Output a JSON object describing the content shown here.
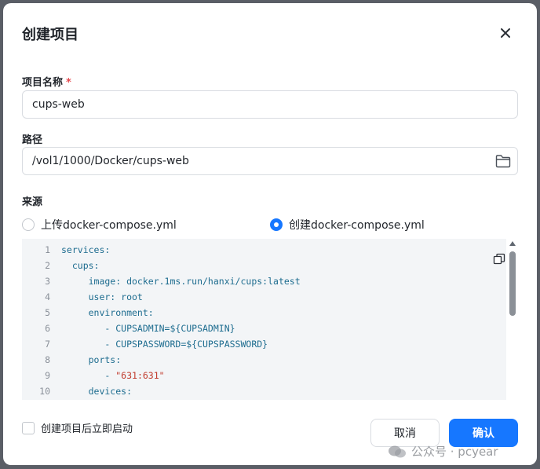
{
  "dialog": {
    "title": "创建项目",
    "close_icon": "close-icon"
  },
  "form": {
    "name_label": "项目名称",
    "name_required_mark": "*",
    "name_value": "cups-web",
    "path_label": "路径",
    "path_value": "/vol1/1000/Docker/cups-web",
    "folder_icon": "folder-icon",
    "source_label": "来源",
    "source_options": [
      {
        "label": "上传docker-compose.yml",
        "selected": false
      },
      {
        "label": "创建docker-compose.yml",
        "selected": true
      }
    ]
  },
  "editor": {
    "lines": [
      {
        "n": "1",
        "text": "services:"
      },
      {
        "n": "2",
        "text": "  cups:"
      },
      {
        "n": "3",
        "text": "     image: docker.1ms.run/hanxi/cups:latest"
      },
      {
        "n": "4",
        "text": "     user: root"
      },
      {
        "n": "5",
        "text": "     environment:"
      },
      {
        "n": "6",
        "text": "        - CUPSADMIN=${CUPSADMIN}"
      },
      {
        "n": "7",
        "text": "        - CUPSPASSWORD=${CUPSPASSWORD}"
      },
      {
        "n": "8",
        "text": "     ports:"
      },
      {
        "n": "9",
        "text": "        - ",
        "str": "\"631:631\""
      },
      {
        "n": "10",
        "text": "     devices:"
      }
    ],
    "copy_icon": "copy-icon"
  },
  "footer": {
    "autostart_label": "创建项目后立即启动",
    "autostart_checked": false,
    "cancel_label": "取消",
    "ok_label": "确认"
  },
  "watermark": {
    "text": "公众号 · pcyear"
  },
  "colors": {
    "primary": "#1677ff",
    "required": "#e5484d",
    "code_key": "#1d6c8f",
    "code_string": "#c0392b",
    "editor_bg": "#f3f5f7"
  }
}
